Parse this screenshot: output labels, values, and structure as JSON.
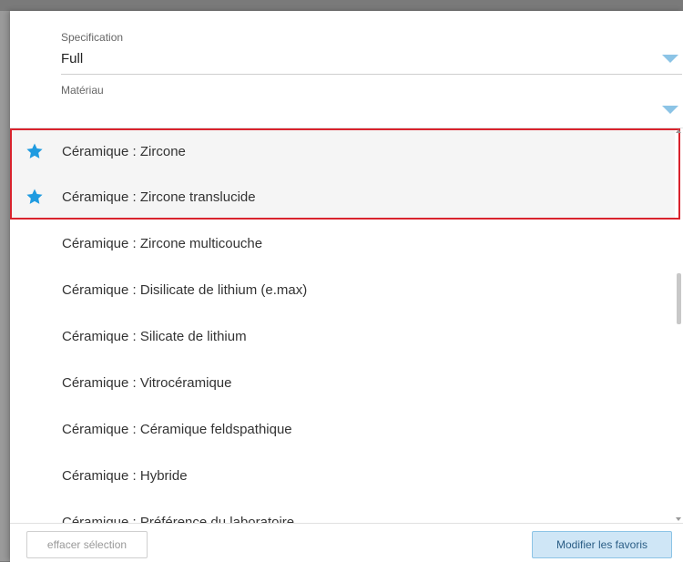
{
  "specification": {
    "label": "Specification",
    "value": "Full"
  },
  "material": {
    "label": "Matériau",
    "value": ""
  },
  "list": {
    "items": [
      {
        "label": "Céramique : Zircone",
        "favorite": true
      },
      {
        "label": "Céramique : Zircone translucide",
        "favorite": true
      },
      {
        "label": "Céramique : Zircone multicouche",
        "favorite": false
      },
      {
        "label": "Céramique : Disilicate de lithium (e.max)",
        "favorite": false
      },
      {
        "label": "Céramique : Silicate de lithium",
        "favorite": false
      },
      {
        "label": "Céramique : Vitrocéramique",
        "favorite": false
      },
      {
        "label": "Céramique : Céramique feldspathique",
        "favorite": false
      },
      {
        "label": "Céramique : Hybride",
        "favorite": false
      },
      {
        "label": "Céramique : Préférence du laboratoire",
        "favorite": false
      }
    ]
  },
  "footer": {
    "clear_label": "effacer sélection",
    "favorites_label": "Modifier les favoris"
  },
  "colors": {
    "accent": "#8cc4e6",
    "star": "#1f9be0",
    "highlight": "#d9232d"
  },
  "icons": {
    "favorite": "star-icon",
    "dropdown": "chevron-down-icon"
  }
}
